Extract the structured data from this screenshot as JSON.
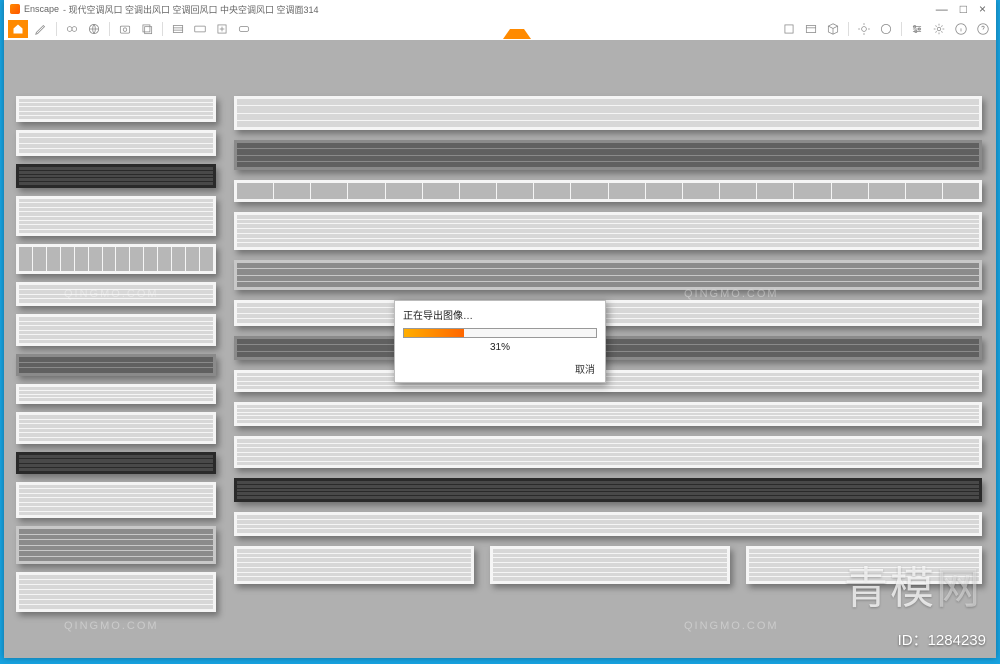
{
  "window": {
    "app_name": "Enscape",
    "title": "- 现代空调风口 空调出风口 空调回风口 中央空调风口 空调面314",
    "minimize": "—",
    "maximize": "□",
    "close": "×"
  },
  "dialog": {
    "title": "正在导出图像…",
    "percent_text": "31%",
    "percent_value": 31,
    "cancel": "取消"
  },
  "watermark": {
    "brand_main": "青模",
    "brand_suffix": "网",
    "url": "QINGMO.COM",
    "id_label": "ID：1284239"
  }
}
